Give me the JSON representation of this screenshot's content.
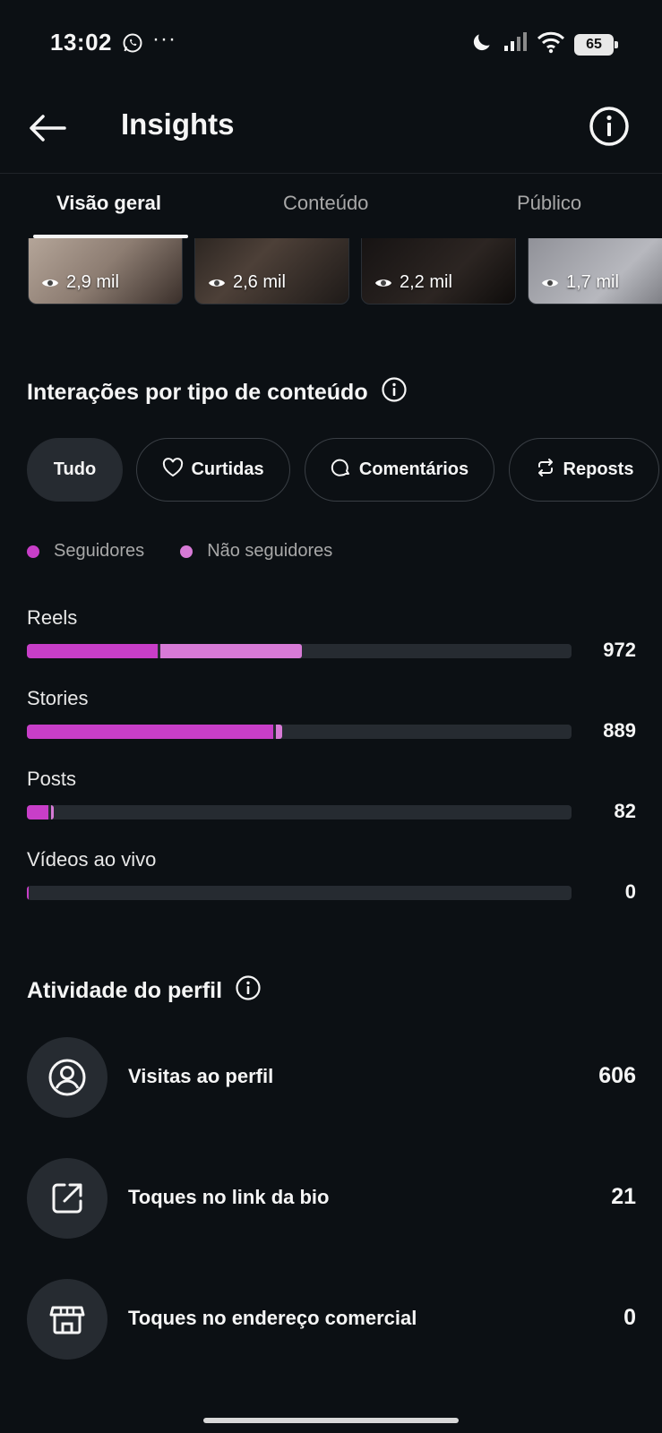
{
  "status_bar": {
    "time": "13:02",
    "dots": "···",
    "battery": "65"
  },
  "header": {
    "title": "Insights"
  },
  "tabs": [
    {
      "label": "Visão geral",
      "active": true
    },
    {
      "label": "Conteúdo",
      "active": false
    },
    {
      "label": "Público",
      "active": false
    }
  ],
  "thumbnails": [
    {
      "views": "2,9 mil"
    },
    {
      "views": "2,6 mil"
    },
    {
      "views": "2,2 mil"
    },
    {
      "views": "1,7 mil"
    }
  ],
  "interactions": {
    "title": "Interações por tipo de conteúdo",
    "filters": [
      {
        "label": "Tudo",
        "active": true
      },
      {
        "label": "Curtidas",
        "icon": "heart-icon"
      },
      {
        "label": "Comentários",
        "icon": "comment-icon"
      },
      {
        "label": "Reposts",
        "icon": "repost-icon"
      }
    ],
    "legend": [
      {
        "label": "Seguidores",
        "color": "#c83ec8"
      },
      {
        "label": "Não seguidores",
        "color": "#d77ad6"
      }
    ],
    "rows": [
      {
        "label": "Reels",
        "value": "972",
        "followers": 0.24,
        "non_followers": 0.26
      },
      {
        "label": "Stories",
        "value": "889",
        "followers": 0.452,
        "non_followers": 0.012
      },
      {
        "label": "Posts",
        "value": "82",
        "followers": 0.04,
        "non_followers": 0.004
      },
      {
        "label": "Vídeos ao vivo",
        "value": "0",
        "followers": 0.004,
        "non_followers": 0
      }
    ]
  },
  "profile_activity": {
    "title": "Atividade do perfil",
    "rows": [
      {
        "label": "Visitas ao perfil",
        "value": "606",
        "icon": "profile-icon"
      },
      {
        "label": "Toques no link da bio",
        "value": "21",
        "icon": "external-link-icon"
      },
      {
        "label": "Toques no endereço comercial",
        "value": "0",
        "icon": "storefront-icon"
      }
    ]
  },
  "colors": {
    "background": "#0c1014",
    "followers": "#c83ec8",
    "non_followers": "#d77ad6",
    "track": "#262b31"
  }
}
